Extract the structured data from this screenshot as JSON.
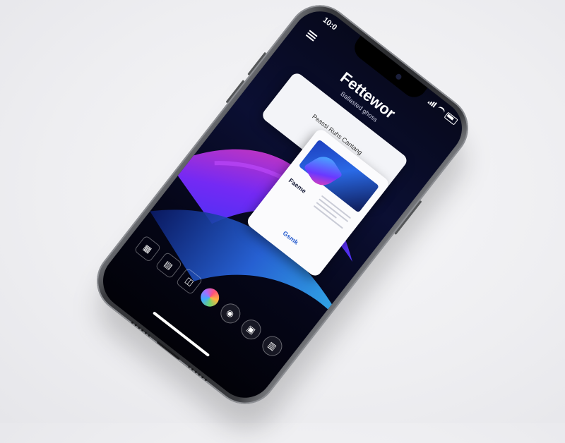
{
  "status_bar": {
    "time": "10:0"
  },
  "app": {
    "title": "Fettewor",
    "subtitle": "Ballasted ghoss"
  },
  "card_top": {
    "label": "Peassi Ruhs Cantang"
  },
  "card_preview": {
    "label": "Faeme",
    "link": "Gsmk"
  },
  "dock": {
    "icons": [
      "grid-icon",
      "calendar-icon",
      "maps-icon",
      "photos-icon",
      "camera-icon",
      "widgets-icon",
      "store-icon"
    ]
  },
  "colors": {
    "screen_bg": "#07091c",
    "accent_blue": "#2a6ae6",
    "accent_magenta": "#ff3fa4",
    "card_bg": "#f3f4f8"
  }
}
